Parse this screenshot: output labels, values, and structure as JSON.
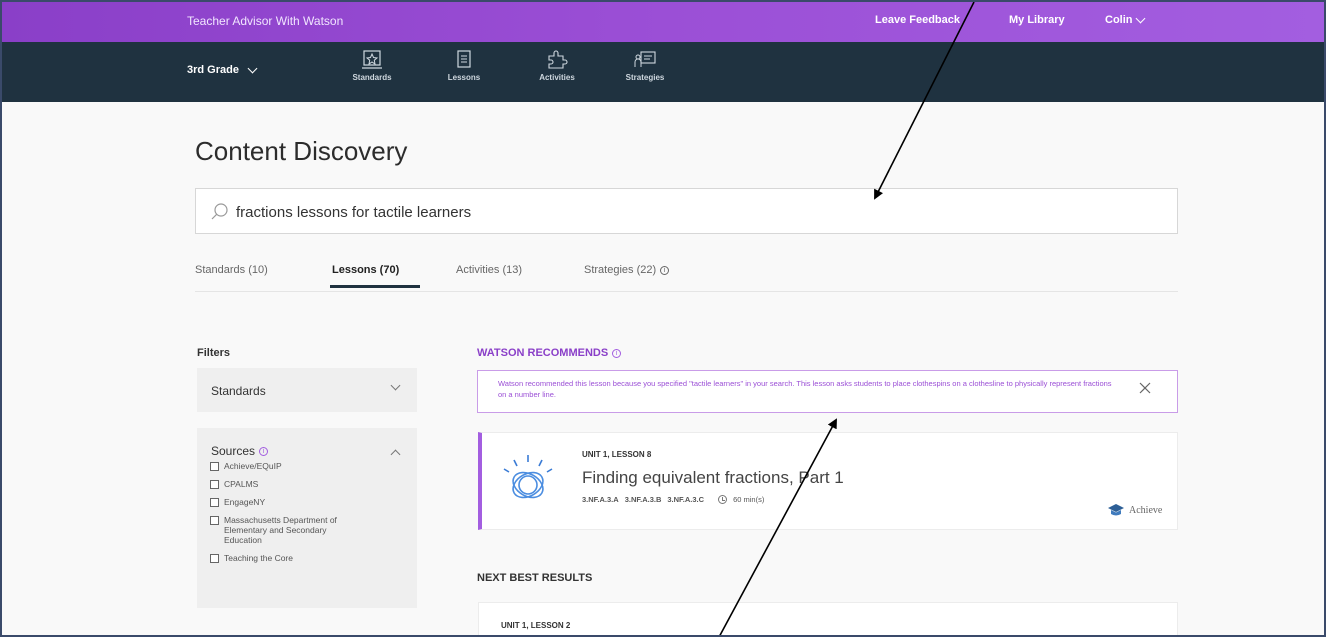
{
  "topbar": {
    "brand": "Teacher Advisor With Watson",
    "feedback": "Leave Feedback",
    "library": "My Library",
    "user": "Colin"
  },
  "navbar": {
    "grade": "3rd Grade",
    "items": [
      {
        "label": "Standards",
        "icon": "standards-icon"
      },
      {
        "label": "Lessons",
        "icon": "lessons-icon"
      },
      {
        "label": "Activities",
        "icon": "activities-icon"
      },
      {
        "label": "Strategies",
        "icon": "strategies-icon"
      }
    ]
  },
  "page": {
    "title": "Content Discovery",
    "search": {
      "value": "fractions lessons for tactile learners"
    }
  },
  "tabs": [
    {
      "label": "Standards (10)"
    },
    {
      "label": "Lessons (70)",
      "active": true
    },
    {
      "label": "Activities (13)"
    },
    {
      "label": "Strategies (22)"
    }
  ],
  "filters": {
    "heading": "Filters",
    "standards_label": "Standards",
    "sources_label": "Sources",
    "sources": [
      "Achieve/EQuIP",
      "CPALMS",
      "EngageNY",
      "Massachusetts Department of Elementary and Secondary Education",
      "Teaching the Core"
    ]
  },
  "results": {
    "watson_heading": "WATSON RECOMMENDS",
    "watson_note": "Watson recommended this lesson because you specified \"tactile learners\" in your search. This lesson asks students to place clothespins on a clothesline to physically represent fractions on a number line.",
    "featured": {
      "unit": "UNIT 1, LESSON 8",
      "title": "Finding equivalent fractions, Part 1",
      "standards": [
        "3.NF.A.3.A",
        "3.NF.A.3.B",
        "3.NF.A.3.C"
      ],
      "duration": "60 min(s)",
      "source": "Achieve"
    },
    "next_heading": "NEXT BEST RESULTS",
    "next": [
      {
        "unit": "UNIT 1, LESSON 2"
      }
    ]
  },
  "colors": {
    "topbar": "#9b4fd6",
    "navbar": "#1f3240",
    "accent": "#a35ee0"
  }
}
